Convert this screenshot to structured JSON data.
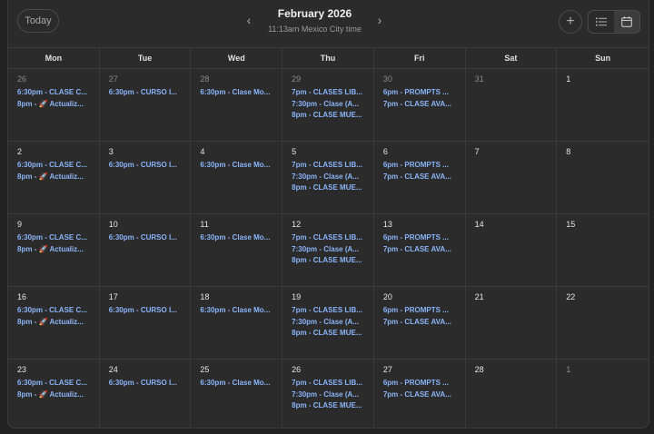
{
  "header": {
    "today_label": "Today",
    "month_title": "February 2026",
    "time_subtitle": "11:13am Mexico City time",
    "prev_icon": "chevron-left-icon",
    "next_icon": "chevron-right-icon",
    "add_icon": "plus-icon",
    "list_view_icon": "list-icon",
    "calendar_view_icon": "calendar-icon"
  },
  "days_of_week": [
    "Mon",
    "Tue",
    "Wed",
    "Thu",
    "Fri",
    "Sat",
    "Sun"
  ],
  "colors": {
    "event": "#8ab4f8",
    "background": "#2b2b2b",
    "grid": "#3a3a3a"
  },
  "weeks": [
    [
      {
        "day": "26",
        "muted": true,
        "events": [
          "6:30pm - CLASE C...",
          "8pm - 🚀 Actualiz..."
        ]
      },
      {
        "day": "27",
        "muted": true,
        "events": [
          "6:30pm - CURSO I..."
        ]
      },
      {
        "day": "28",
        "muted": true,
        "events": [
          "6:30pm - Clase Mo..."
        ]
      },
      {
        "day": "29",
        "muted": true,
        "events": [
          "7pm - CLASES LIB...",
          "7:30pm - Clase (A...",
          "8pm - CLASE MUE..."
        ]
      },
      {
        "day": "30",
        "muted": true,
        "events": [
          "6pm - PROMPTS ...",
          "7pm - CLASE AVA..."
        ]
      },
      {
        "day": "31",
        "muted": true,
        "events": []
      },
      {
        "day": "1",
        "muted": false,
        "events": []
      }
    ],
    [
      {
        "day": "2",
        "muted": false,
        "events": [
          "6:30pm - CLASE C...",
          "8pm - 🚀 Actualiz..."
        ]
      },
      {
        "day": "3",
        "muted": false,
        "events": [
          "6:30pm - CURSO I..."
        ]
      },
      {
        "day": "4",
        "muted": false,
        "events": [
          "6:30pm - Clase Mo..."
        ]
      },
      {
        "day": "5",
        "muted": false,
        "events": [
          "7pm - CLASES LIB...",
          "7:30pm - Clase (A...",
          "8pm - CLASE MUE..."
        ]
      },
      {
        "day": "6",
        "muted": false,
        "events": [
          "6pm - PROMPTS ...",
          "7pm - CLASE AVA..."
        ]
      },
      {
        "day": "7",
        "muted": false,
        "events": []
      },
      {
        "day": "8",
        "muted": false,
        "events": []
      }
    ],
    [
      {
        "day": "9",
        "muted": false,
        "events": [
          "6:30pm - CLASE C...",
          "8pm - 🚀 Actualiz..."
        ]
      },
      {
        "day": "10",
        "muted": false,
        "events": [
          "6:30pm - CURSO I..."
        ]
      },
      {
        "day": "11",
        "muted": false,
        "events": [
          "6:30pm - Clase Mo..."
        ]
      },
      {
        "day": "12",
        "muted": false,
        "events": [
          "7pm - CLASES LIB...",
          "7:30pm - Clase (A...",
          "8pm - CLASE MUE..."
        ]
      },
      {
        "day": "13",
        "muted": false,
        "events": [
          "6pm - PROMPTS ...",
          "7pm - CLASE AVA..."
        ]
      },
      {
        "day": "14",
        "muted": false,
        "events": []
      },
      {
        "day": "15",
        "muted": false,
        "events": []
      }
    ],
    [
      {
        "day": "16",
        "muted": false,
        "events": [
          "6:30pm - CLASE C...",
          "8pm - 🚀 Actualiz..."
        ]
      },
      {
        "day": "17",
        "muted": false,
        "events": [
          "6:30pm - CURSO I..."
        ]
      },
      {
        "day": "18",
        "muted": false,
        "events": [
          "6:30pm - Clase Mo..."
        ]
      },
      {
        "day": "19",
        "muted": false,
        "events": [
          "7pm - CLASES LIB...",
          "7:30pm - Clase (A...",
          "8pm - CLASE MUE..."
        ]
      },
      {
        "day": "20",
        "muted": false,
        "events": [
          "6pm - PROMPTS ...",
          "7pm - CLASE AVA..."
        ]
      },
      {
        "day": "21",
        "muted": false,
        "events": []
      },
      {
        "day": "22",
        "muted": false,
        "events": []
      }
    ],
    [
      {
        "day": "23",
        "muted": false,
        "events": [
          "6:30pm - CLASE C...",
          "8pm - 🚀 Actualiz..."
        ]
      },
      {
        "day": "24",
        "muted": false,
        "events": [
          "6:30pm - CURSO I..."
        ]
      },
      {
        "day": "25",
        "muted": false,
        "events": [
          "6:30pm - Clase Mo..."
        ]
      },
      {
        "day": "26",
        "muted": false,
        "events": [
          "7pm - CLASES LIB...",
          "7:30pm - Clase (A...",
          "8pm - CLASE MUE..."
        ]
      },
      {
        "day": "27",
        "muted": false,
        "events": [
          "6pm - PROMPTS ...",
          "7pm - CLASE AVA..."
        ]
      },
      {
        "day": "28",
        "muted": false,
        "events": []
      },
      {
        "day": "1",
        "muted": true,
        "events": []
      }
    ]
  ]
}
